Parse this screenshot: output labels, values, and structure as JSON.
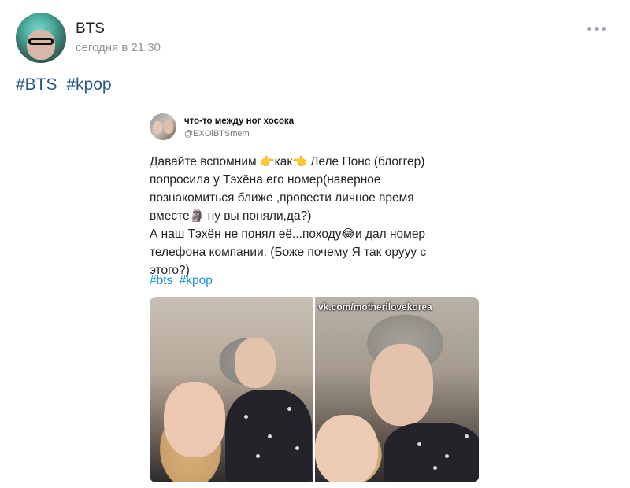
{
  "post": {
    "author": "BTS",
    "time": "сегодня в 21:30",
    "hashtags": [
      "#BTS",
      "#kpop"
    ]
  },
  "embed": {
    "account_name": "что-то между ног хосока",
    "account_handle": "@EXOiBTSmem",
    "text_lines": [
      "Давайте вспомним",
      "как",
      "Леле Понс (блоггер)",
      "попросила у Тэхёна его номер(наверное",
      "познакомиться ближе ,провести личное время",
      "вместе",
      "ну вы поняли,да?)",
      "А наш Тэхён не понял её...походу",
      "и дал номер",
      "телефона компании. (Боже почему Я так оруyy с",
      "этого?)"
    ],
    "emoji": {
      "point_right": "👉",
      "point_left": "👈",
      "moai": "🗿",
      "joy": "😂"
    },
    "tags": [
      "#bts",
      "#kpop"
    ],
    "watermark": "vk.com/motherilovekorea"
  },
  "icons": {
    "more": "more-horizontal-icon"
  }
}
